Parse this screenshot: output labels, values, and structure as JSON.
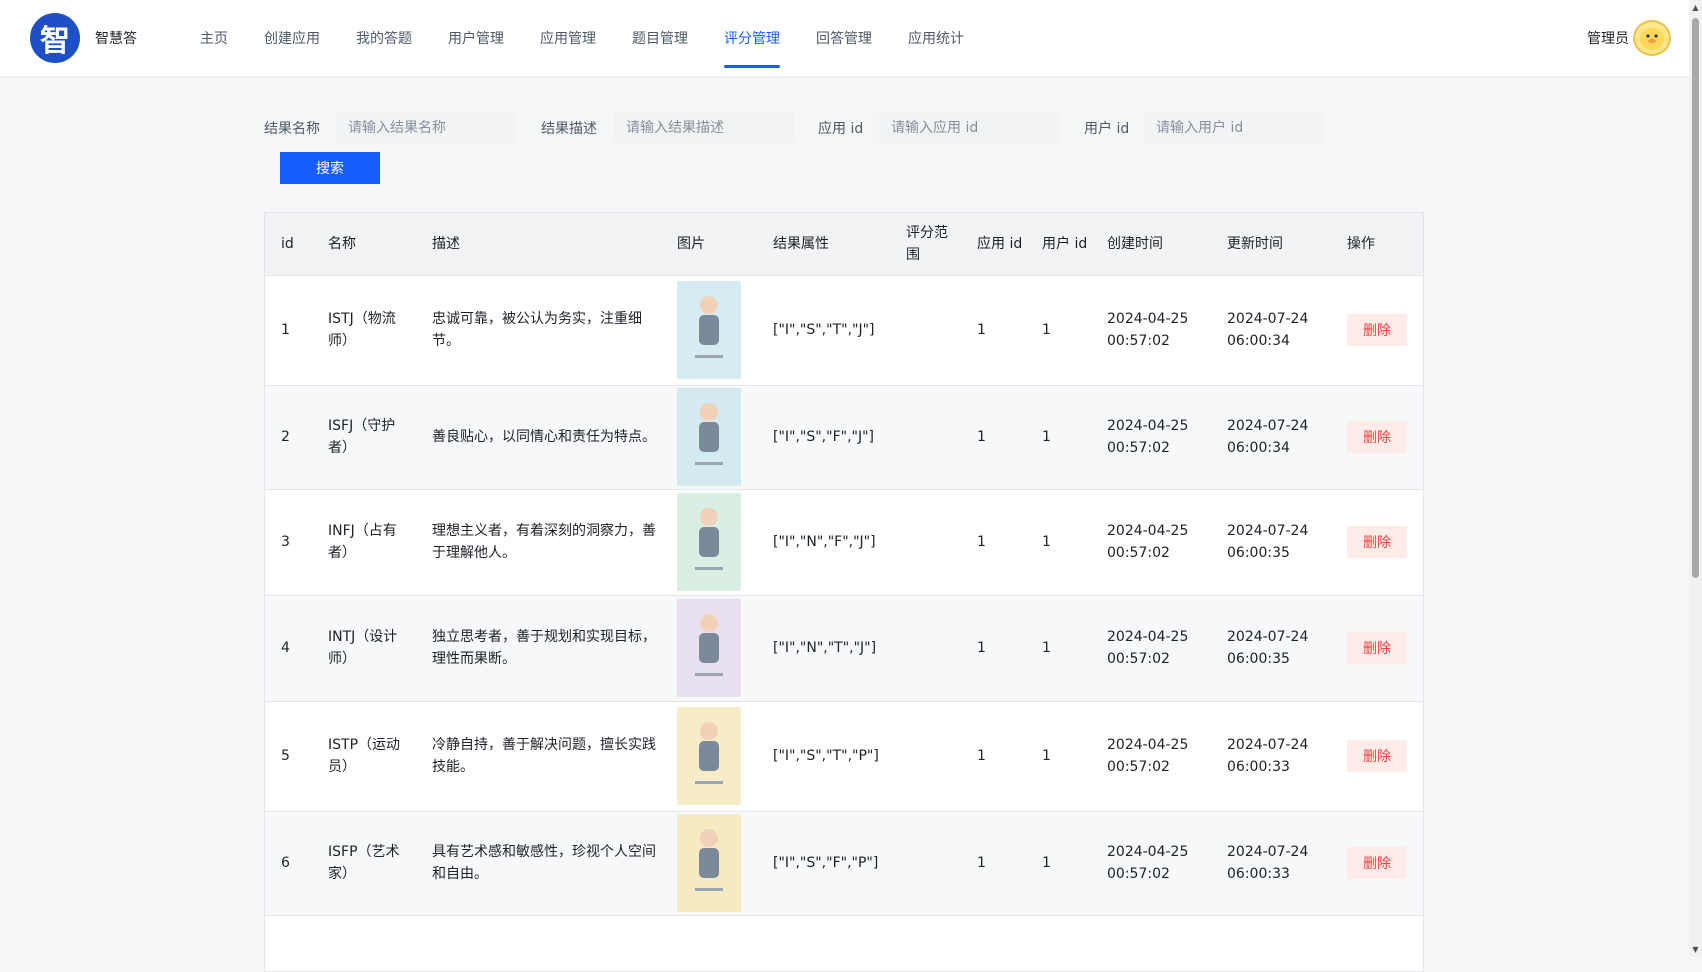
{
  "header": {
    "logo_glyph": "智",
    "app_name": "智慧答",
    "nav": [
      {
        "label": "主页",
        "active": false
      },
      {
        "label": "创建应用",
        "active": false
      },
      {
        "label": "我的答题",
        "active": false
      },
      {
        "label": "用户管理",
        "active": false
      },
      {
        "label": "应用管理",
        "active": false
      },
      {
        "label": "题目管理",
        "active": false
      },
      {
        "label": "评分管理",
        "active": true
      },
      {
        "label": "回答管理",
        "active": false
      },
      {
        "label": "应用统计",
        "active": false
      }
    ],
    "user_name": "管理员"
  },
  "search": {
    "fields": [
      {
        "label": "结果名称",
        "placeholder": "请输入结果名称",
        "value": ""
      },
      {
        "label": "结果描述",
        "placeholder": "请输入结果描述",
        "value": ""
      },
      {
        "label": "应用 id",
        "placeholder": "请输入应用 id",
        "value": ""
      },
      {
        "label": "用户 id",
        "placeholder": "请输入用户 id",
        "value": ""
      }
    ],
    "button_label": "搜索"
  },
  "table": {
    "columns": [
      "id",
      "名称",
      "描述",
      "图片",
      "结果属性",
      "评分范围",
      "应用 id",
      "用户 id",
      "创建时间",
      "更新时间",
      "操作"
    ],
    "delete_label": "删除",
    "rows": [
      {
        "id": "1",
        "name": "ISTJ（物流师）",
        "desc": "忠诚可靠，被公认为务实，注重细节。",
        "attrs": "[\"I\",\"S\",\"T\",\"J\"]",
        "range": "",
        "app_id": "1",
        "user_id": "1",
        "created": "2024-04-25 00:57:02",
        "updated": "2024-07-24 06:00:34",
        "img_color": "#d7ecf2"
      },
      {
        "id": "2",
        "name": "ISFJ（守护者）",
        "desc": "善良贴心，以同情心和责任为特点。",
        "attrs": "[\"I\",\"S\",\"F\",\"J\"]",
        "range": "",
        "app_id": "1",
        "user_id": "1",
        "created": "2024-04-25 00:57:02",
        "updated": "2024-07-24 06:00:34",
        "img_color": "#d3eaf0"
      },
      {
        "id": "3",
        "name": "INFJ（占有者）",
        "desc": "理想主义者，有着深刻的洞察力，善于理解他人。",
        "attrs": "[\"I\",\"N\",\"F\",\"J\"]",
        "range": "",
        "app_id": "1",
        "user_id": "1",
        "created": "2024-04-25 00:57:02",
        "updated": "2024-07-24 06:00:35",
        "img_color": "#d9efe3"
      },
      {
        "id": "4",
        "name": "INTJ（设计师）",
        "desc": "独立思考者，善于规划和实现目标，理性而果断。",
        "attrs": "[\"I\",\"N\",\"T\",\"J\"]",
        "range": "",
        "app_id": "1",
        "user_id": "1",
        "created": "2024-04-25 00:57:02",
        "updated": "2024-07-24 06:00:35",
        "img_color": "#e8e0ee"
      },
      {
        "id": "5",
        "name": "ISTP（运动员）",
        "desc": "冷静自持，善于解决问题，擅长实践技能。",
        "attrs": "[\"I\",\"S\",\"T\",\"P\"]",
        "range": "",
        "app_id": "1",
        "user_id": "1",
        "created": "2024-04-25 00:57:02",
        "updated": "2024-07-24 06:00:33",
        "img_color": "#f6ecc8"
      },
      {
        "id": "6",
        "name": "ISFP（艺术家）",
        "desc": "具有艺术感和敏感性，珍视个人空间和自由。",
        "attrs": "[\"I\",\"S\",\"F\",\"P\"]",
        "range": "",
        "app_id": "1",
        "user_id": "1",
        "created": "2024-04-25 00:57:02",
        "updated": "2024-07-24 06:00:33",
        "img_color": "#f6eac2"
      }
    ]
  },
  "colors": {
    "accent": "#165dff",
    "danger": "#f53f3f",
    "danger_bg": "#ffece8"
  }
}
